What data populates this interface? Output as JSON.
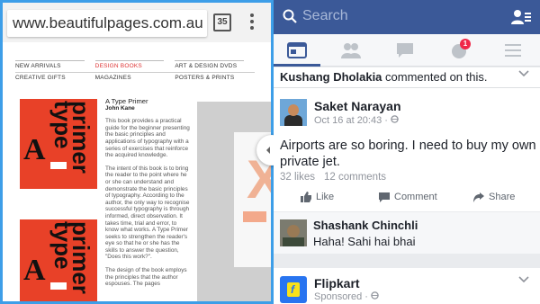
{
  "browser": {
    "url": "www.beautifulpages.com.au",
    "tab_count": "35"
  },
  "site": {
    "menu_row1": [
      "NEW ARRIVALS",
      "DESIGN BOOKS",
      "ART & DESIGN DVDS"
    ],
    "menu_row2": [
      "CREATIVE GIFTS",
      "MAGAZINES",
      "POSTERS & PRINTS"
    ],
    "book": {
      "cover_a": "A",
      "cover_word1": "type",
      "cover_word2": "primer",
      "title": "A Type Primer",
      "author": "John Kane",
      "para1": "This book provides a practical guide for the beginner presenting the basic principles and applications of typography with a series of exercises that reinforce the acquired knowledge.",
      "para2": "The intent of this book is to bring the reader to the point where he or she can understand and demonstrate the basic principles of typography. According to the author, the only way to recognise successful typography is through informed, direct observation. It takes time, trial and error, to know what works. A Type Primer seeks to strengthen the reader's eye so that he or she has the skills to answer the question, \"Does this work?\".",
      "para3": "The design of the book employs the principles that the author espouses. The pages"
    }
  },
  "facebook": {
    "search_placeholder": "Search",
    "notification_count": "1",
    "context_user": "Kushang Dholakia",
    "context_text": " commented on this.",
    "post": {
      "author": "Saket Narayan",
      "time": "Oct 16 at 20:43 · ",
      "text": "Airports are so boring. I need to buy my own private jet.",
      "likes": "32 likes",
      "comments": "12 comments",
      "like_label": "Like",
      "comment_label": "Comment",
      "share_label": "Share"
    },
    "comment": {
      "author": "Shashank Chinchli",
      "text": "Haha! Sahi hai bhai"
    },
    "sponsored": {
      "author": "Flipkart",
      "label": "Sponsored · "
    }
  },
  "colors": {
    "fb_blue": "#3b5998",
    "split_accent": "#3d9ee8",
    "book_red": "#e84128"
  }
}
